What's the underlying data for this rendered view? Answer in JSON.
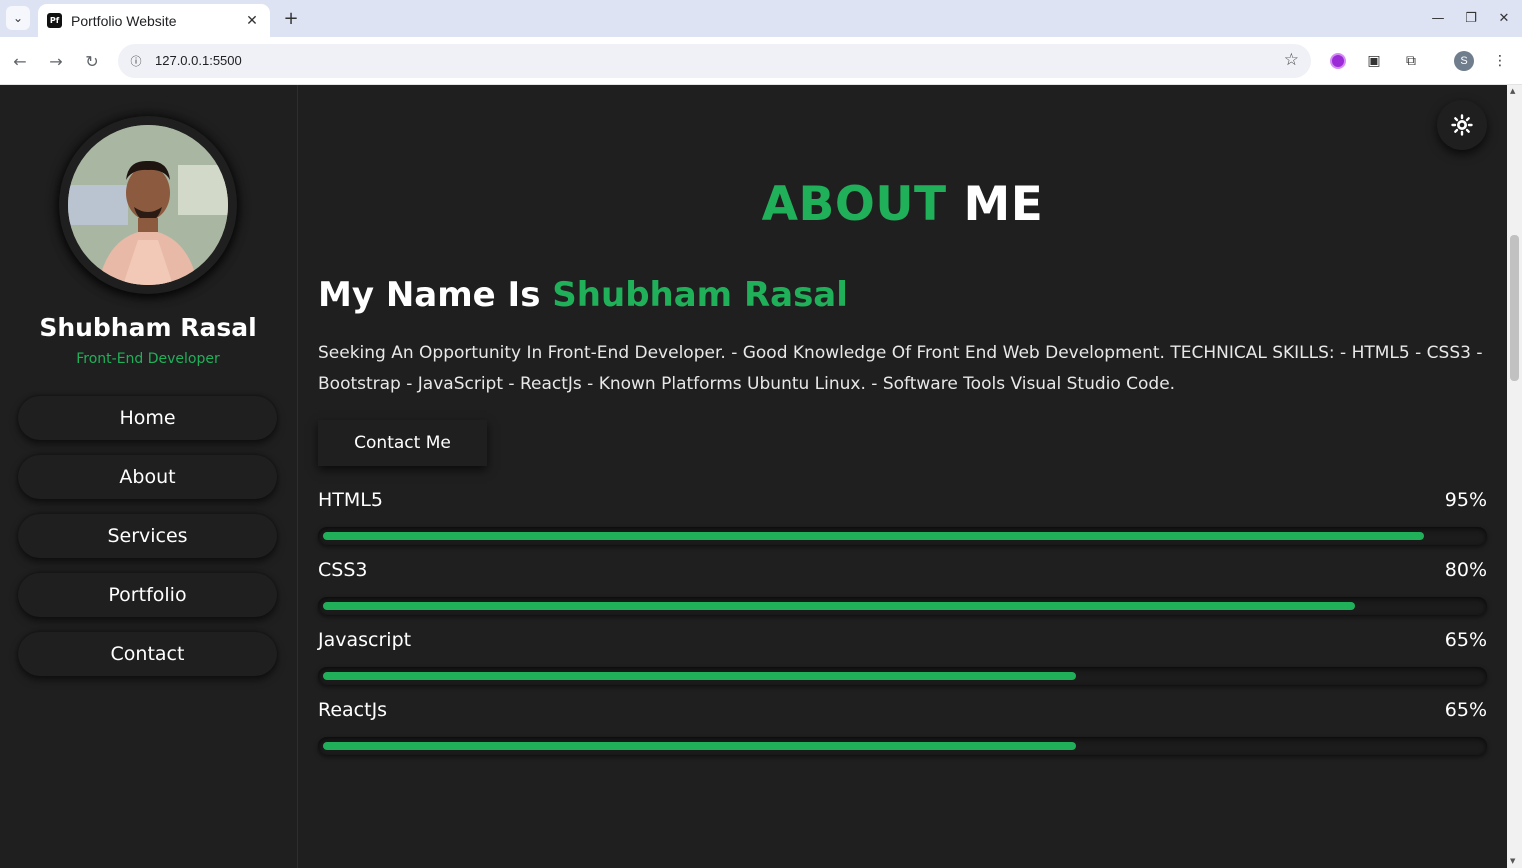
{
  "browser": {
    "tab_title": "Portfolio Website",
    "favicon_text": "Pf",
    "url": "127.0.0.1:5500",
    "profile_initial": "S"
  },
  "sidebar": {
    "name": "Shubham Rasal",
    "role": "Front-End Developer",
    "menu": [
      "Home",
      "About",
      "Services",
      "Portfolio",
      "Contact"
    ]
  },
  "about": {
    "title_accent": "ABOUT",
    "title_rest": "ME",
    "name_prefix": "My Name Is",
    "name_highlight": "Shubham Rasal",
    "bio": "Seeking An Opportunity In Front-End Developer. - Good Knowledge Of Front End Web Development. TECHNICAL SKILLS: - HTML5 - CSS3 - Bootstrap - JavaScript - ReactJs - Known Platforms Ubuntu Linux. - Software Tools Visual Studio Code.",
    "contact_button": "Contact Me",
    "skills": [
      {
        "name": "HTML5",
        "percent_label": "95%",
        "fill": 0.95
      },
      {
        "name": "CSS3",
        "percent_label": "80%",
        "fill": 0.89
      },
      {
        "name": "Javascript",
        "percent_label": "65%",
        "fill": 0.65
      },
      {
        "name": "ReactJs",
        "percent_label": "65%",
        "fill": 0.65
      }
    ]
  },
  "colors": {
    "accent": "#20b05a",
    "background": "#1f1f1f"
  },
  "icons": {
    "theme_toggle": "sun-icon"
  }
}
